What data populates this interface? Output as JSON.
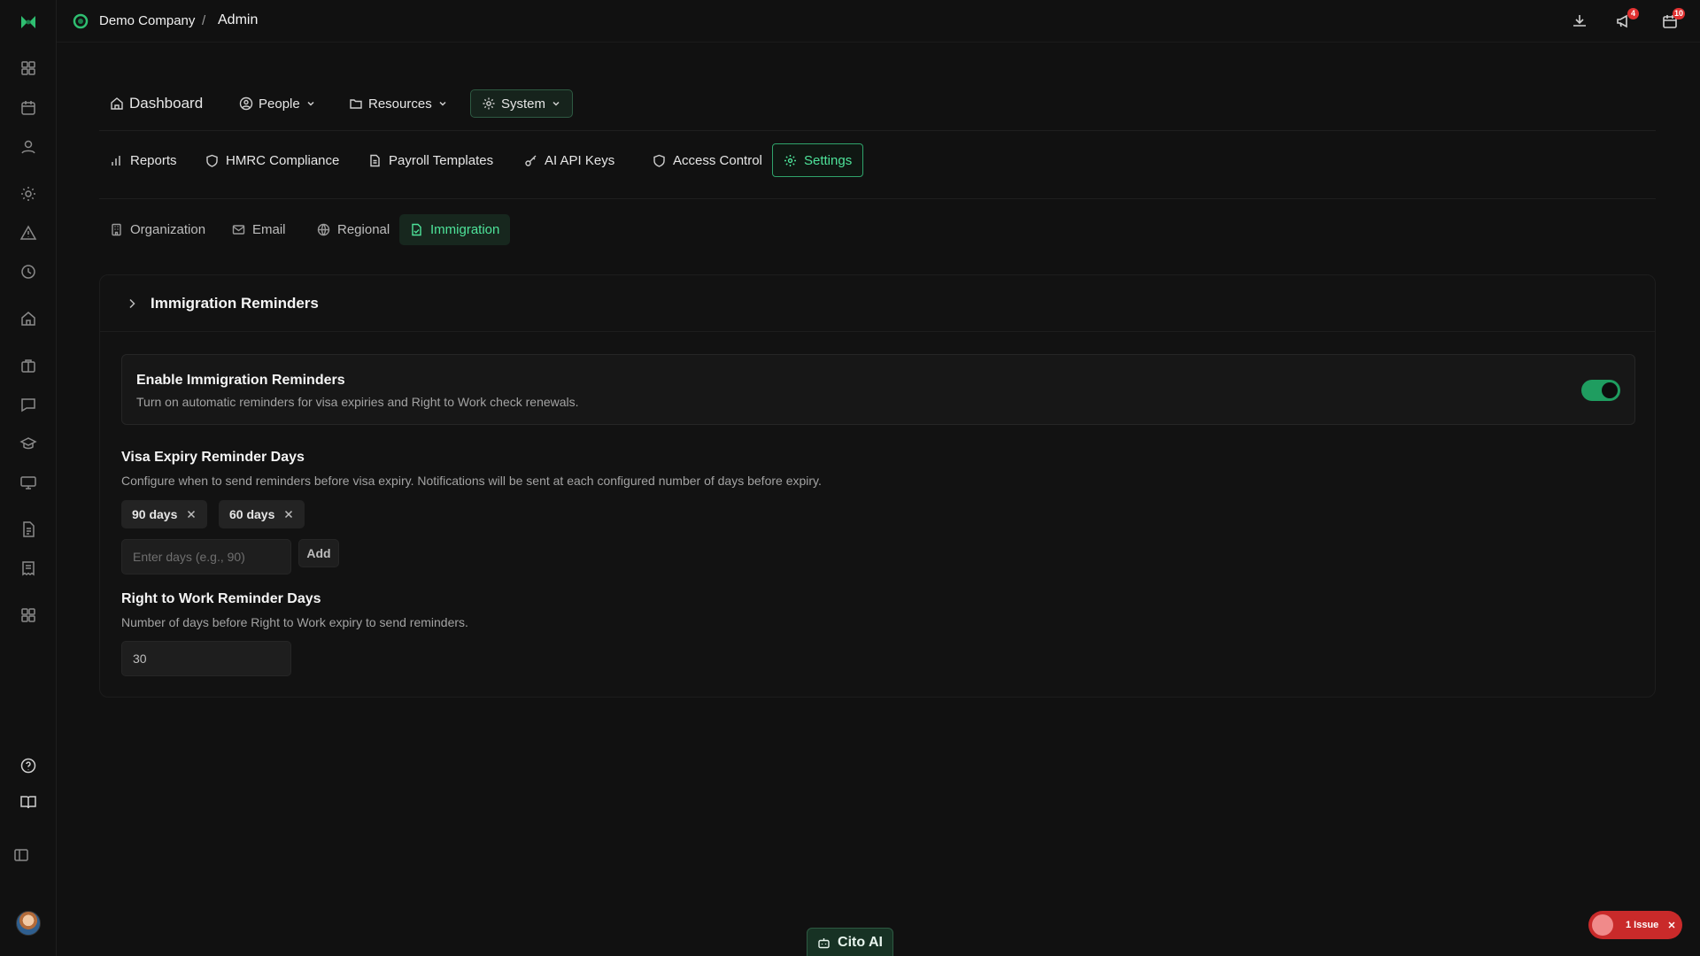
{
  "header": {
    "company": "Demo Company",
    "separator": "/",
    "page": "Admin",
    "notifications_count": "4",
    "calendar_count": "10",
    "actions": [
      "download-icon",
      "megaphone-icon",
      "calendar-icon"
    ]
  },
  "sidebar": {
    "icons": [
      "dashboard-grid-icon",
      "calendar-icon",
      "user-icon",
      "sun-icon",
      "alert-icon",
      "clock-icon",
      "home-icon",
      "briefcase-icon",
      "chat-icon",
      "graduation-cap-icon",
      "monitor-icon",
      "document-icon",
      "receipt-icon",
      "apps-icon",
      "help-icon",
      "book-icon",
      "panel-toggle-icon"
    ]
  },
  "mainnav": {
    "dashboard": "Dashboard",
    "people": "People",
    "resources": "Resources",
    "system": "System"
  },
  "subnav": {
    "reports": "Reports",
    "hmrc": "HMRC Compliance",
    "payroll": "Payroll Templates",
    "ai_keys": "AI API Keys",
    "access": "Access Control",
    "settings": "Settings"
  },
  "tabs": {
    "organization": "Organization",
    "email": "Email",
    "regional": "Regional",
    "immigration": "Immigration"
  },
  "card": {
    "title": "Immigration Reminders",
    "enable_title": "Enable Immigration Reminders",
    "enable_desc": "Turn on automatic reminders for visa expiries and Right to Work check renewals.",
    "enabled": true,
    "visa_title": "Visa Expiry Reminder Days",
    "visa_desc": "Configure when to send reminders before visa expiry. Notifications will be sent at each configured number of days before expiry.",
    "visa_chips": [
      "90 days",
      "60 days"
    ],
    "days_placeholder": "Enter days (e.g., 90)",
    "add_label": "Add",
    "rtw_title": "Right to Work Reminder Days",
    "rtw_desc": "Number of days before Right to Work expiry to send reminders.",
    "rtw_value": "30"
  },
  "footer": {
    "cito_label": "Cito AI",
    "issue_label": "1 Issue"
  },
  "colors": {
    "accent": "#4ee39a",
    "toggle_on": "#1f9d60",
    "issue": "#c92a2a"
  }
}
